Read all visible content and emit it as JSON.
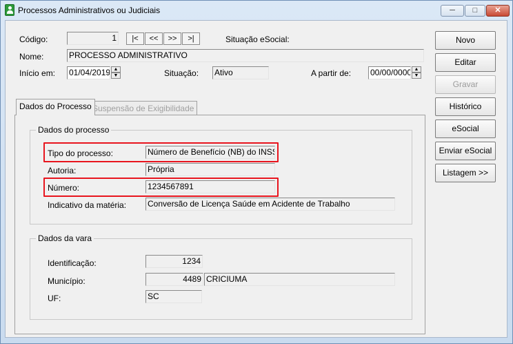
{
  "window": {
    "title": "Processos Administrativos ou Judiciais"
  },
  "header": {
    "codigo_label": "Código:",
    "codigo_value": "1",
    "nav_buttons": [
      "|<",
      "<<",
      ">>",
      ">|"
    ],
    "situacao_esocial_label": "Situação eSocial:",
    "nome_label": "Nome:",
    "nome_value": "PROCESSO ADMINISTRATIVO",
    "inicio_label": "Início em:",
    "inicio_value": "01/04/2019",
    "situacao_label": "Situação:",
    "situacao_value": "Ativo",
    "a_partir_label": "A partir de:",
    "a_partir_value": "00/00/0000"
  },
  "side_buttons": {
    "novo": "Novo",
    "editar": "Editar",
    "gravar": "Gravar",
    "historico": "Histórico",
    "esocial": "eSocial",
    "enviar_esocial": "Enviar eSocial",
    "listagem": "Listagem >>"
  },
  "tabs": {
    "dados_processo": "Dados do Processo",
    "suspensao": "Suspensão de Exigibilidade"
  },
  "dados_processo": {
    "group_title": "Dados do processo",
    "tipo_label": "Tipo do processo:",
    "tipo_value": "Número de Benefício (NB) do INSS",
    "autoria_label": "Autoria:",
    "autoria_value": "Própria",
    "numero_label": "Número:",
    "numero_value": "1234567891",
    "indicativo_label": "Indicativo da matéria:",
    "indicativo_value": "Conversão de Licença Saúde em Acidente de Trabalho"
  },
  "dados_vara": {
    "group_title": "Dados da vara",
    "identificacao_label": "Identificação:",
    "identificacao_value": "1234",
    "municipio_label": "Município:",
    "municipio_code": "4489",
    "municipio_name": "CRICIUMA",
    "uf_label": "UF:",
    "uf_value": "SC"
  },
  "highlight_color": "#e8141d"
}
